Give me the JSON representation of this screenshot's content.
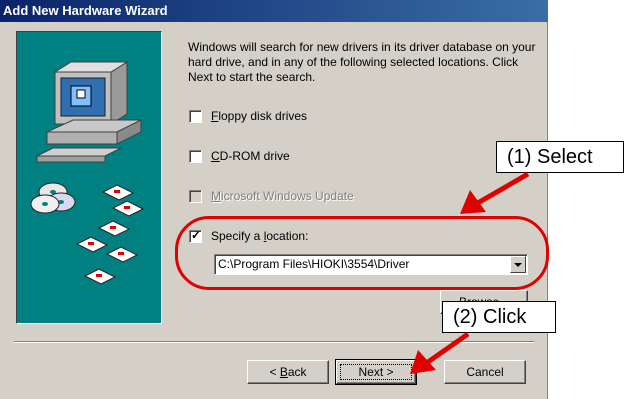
{
  "window": {
    "title": "Add New Hardware Wizard"
  },
  "description": "Windows will search for new drivers in its driver database on your hard drive, and in any of the following selected locations. Click Next to start the search.",
  "options": [
    {
      "label_mnemonic": "F",
      "label_rest": "loppy disk drives",
      "checked": false,
      "enabled": true
    },
    {
      "label_mnemonic": "C",
      "label_rest": "D-ROM drive",
      "checked": false,
      "enabled": true
    },
    {
      "label_mnemonic": "M",
      "label_rest": "icrosoft Windows Update",
      "checked": false,
      "enabled": false
    },
    {
      "label_pre": "Specify a ",
      "label_mnemonic": "l",
      "label_rest": "ocation:",
      "checked": true,
      "enabled": true
    }
  ],
  "location": {
    "value": "C:\\Program Files\\HIOKI\\3554\\Driver"
  },
  "buttons": {
    "browse": "Browse...",
    "back_pre": "< ",
    "back_mnemonic": "B",
    "back_rest": "ack",
    "next": "Next >",
    "cancel": "Cancel"
  },
  "annotations": {
    "select": "(1) Select",
    "click": "(2) Click",
    "color": "#e00000"
  },
  "icons": [
    "computer-icon",
    "cd-discs-icon",
    "floppy-disks-icon"
  ]
}
